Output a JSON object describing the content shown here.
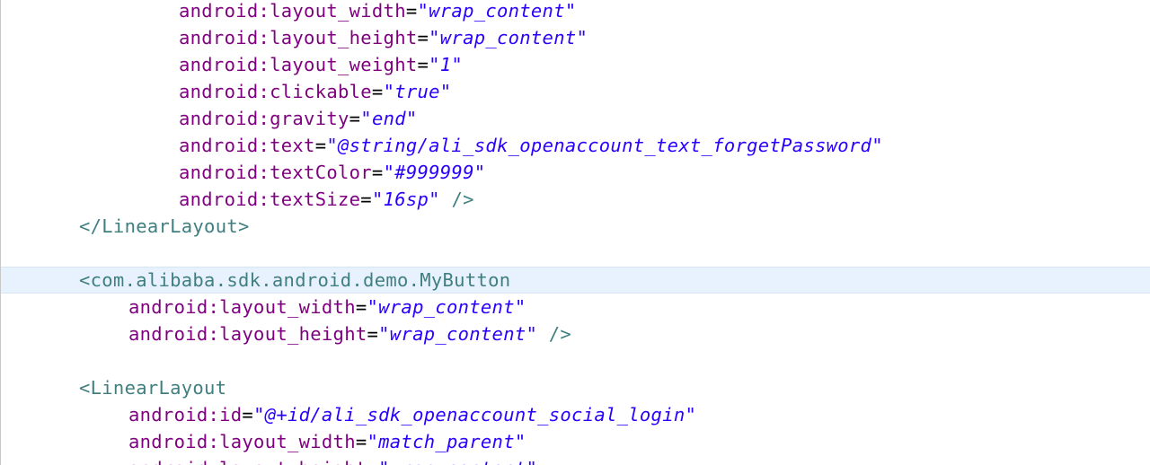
{
  "editor": {
    "lines": [
      {
        "type": "attr",
        "indent": 198,
        "attr": "android:layout_width",
        "value": "\"wrap_content\"",
        "end": ""
      },
      {
        "type": "attr",
        "indent": 198,
        "attr": "android:layout_height",
        "value": "\"wrap_content\"",
        "end": ""
      },
      {
        "type": "attr",
        "indent": 198,
        "attr": "android:layout_weight",
        "value": "\"1\"",
        "end": ""
      },
      {
        "type": "attr",
        "indent": 198,
        "attr": "android:clickable",
        "value": "\"true\"",
        "end": ""
      },
      {
        "type": "attr",
        "indent": 198,
        "attr": "android:gravity",
        "value": "\"end\"",
        "end": ""
      },
      {
        "type": "attr",
        "indent": 198,
        "attr": "android:text",
        "value": "\"@string/ali_sdk_openaccount_text_forgetPassword\"",
        "end": ""
      },
      {
        "type": "attr",
        "indent": 198,
        "attr": "android:textColor",
        "value": "\"#999999\"",
        "end": ""
      },
      {
        "type": "attr",
        "indent": 198,
        "attr": "android:textSize",
        "value": "\"16sp\"",
        "end": " />"
      },
      {
        "type": "tag",
        "indent": 87,
        "text": "</LinearLayout>"
      },
      {
        "type": "blank"
      },
      {
        "type": "tag",
        "indent": 87,
        "text": "<com.alibaba.sdk.android.demo.MyButton",
        "current": true
      },
      {
        "type": "attr",
        "indent": 142,
        "attr": "android:layout_width",
        "value": "\"wrap_content\"",
        "end": ""
      },
      {
        "type": "attr",
        "indent": 142,
        "attr": "android:layout_height",
        "value": "\"wrap_content\"",
        "end": " />"
      },
      {
        "type": "blank"
      },
      {
        "type": "tag",
        "indent": 87,
        "text": "<LinearLayout"
      },
      {
        "type": "attr",
        "indent": 142,
        "attr": "android:id",
        "value": "\"@+id/ali_sdk_openaccount_social_login\"",
        "end": ""
      },
      {
        "type": "attr",
        "indent": 142,
        "attr": "android:layout_width",
        "value": "\"match_parent\"",
        "end": ""
      },
      {
        "type": "attr",
        "indent": 142,
        "attr": "android:layout_height",
        "value": "\"wrap_content\"",
        "end": ""
      }
    ]
  },
  "colors": {
    "tag": "#3f7f7f",
    "attribute": "#7f007f",
    "value": "#2a00ff",
    "current_line": "#e8f2fe"
  }
}
